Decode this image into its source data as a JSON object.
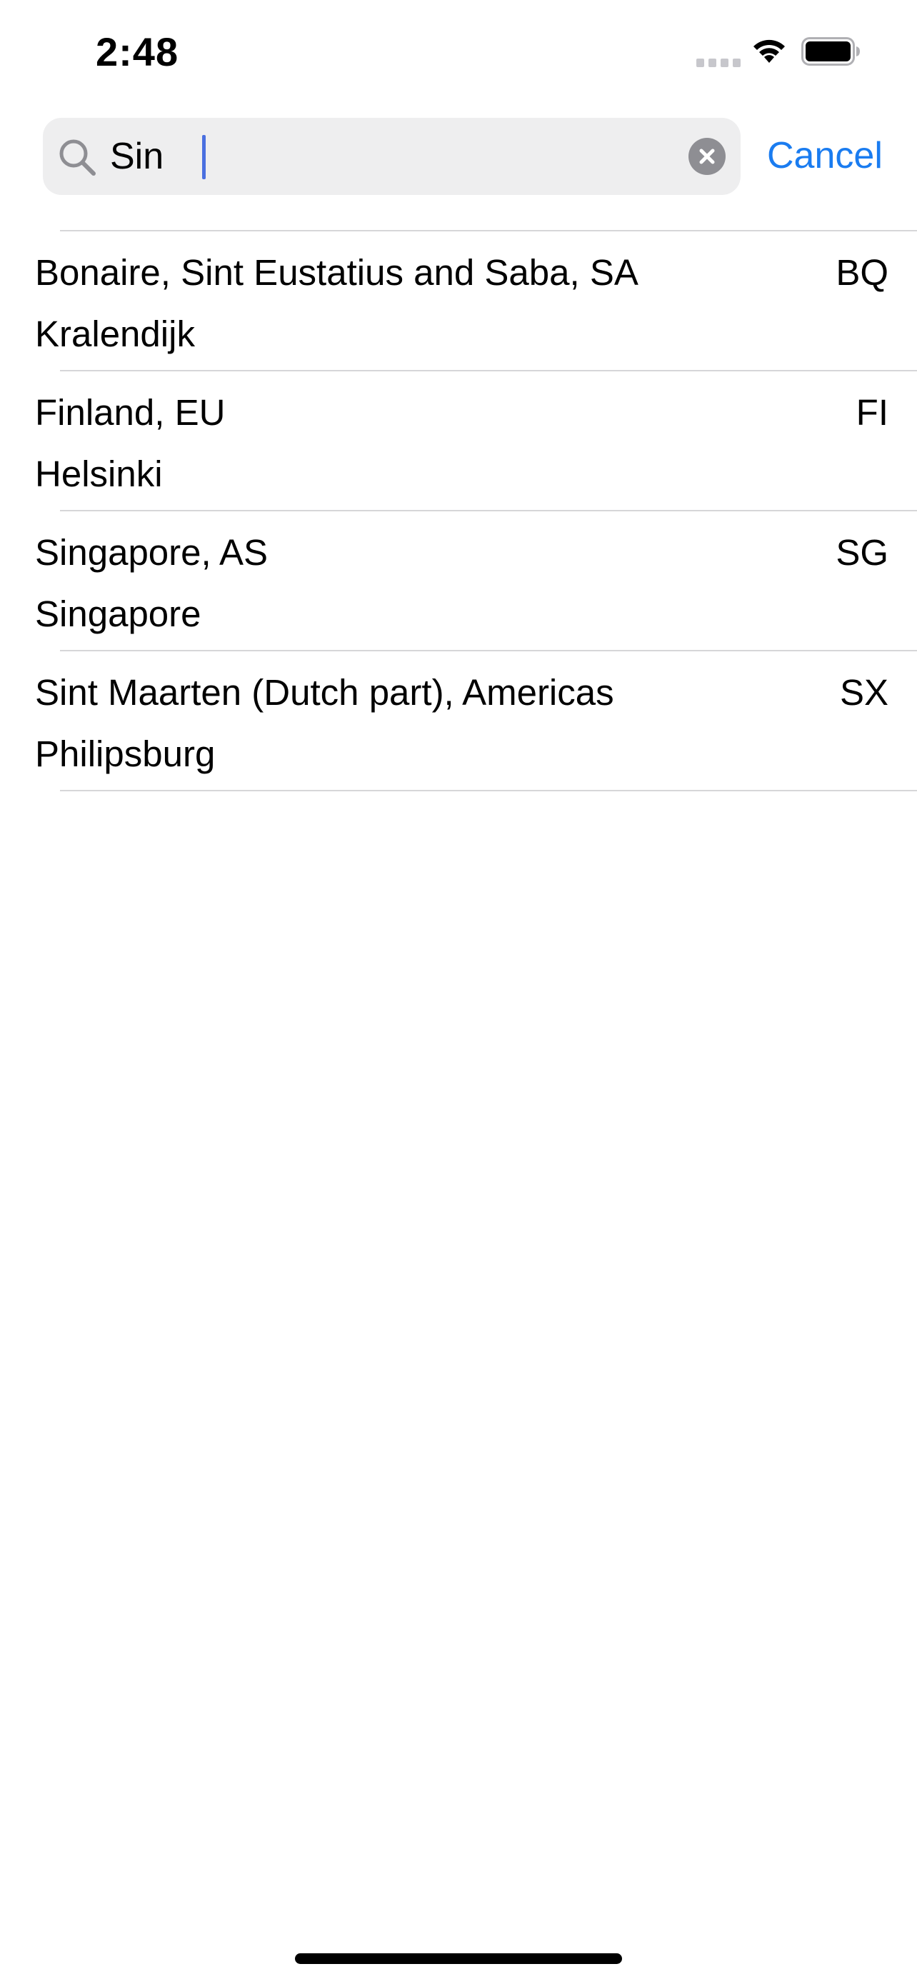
{
  "status_bar": {
    "time": "2:48",
    "icons": [
      "cellular-signal-icon",
      "wifi-icon",
      "battery-icon"
    ]
  },
  "search": {
    "value": "Sin",
    "cancel_label": "Cancel",
    "icon": "search-icon",
    "clear_icon": "clear-icon"
  },
  "results": [
    {
      "title": "Bonaire, Sint Eustatius and Saba, SA",
      "subtitle": "Kralendijk",
      "code": "BQ"
    },
    {
      "title": "Finland, EU",
      "subtitle": "Helsinki",
      "code": "FI"
    },
    {
      "title": "Singapore, AS",
      "subtitle": "Singapore",
      "code": "SG"
    },
    {
      "title": "Sint Maarten (Dutch part), Americas",
      "subtitle": "Philipsburg",
      "code": "SX"
    }
  ],
  "colors": {
    "accent": "#1a7cf0",
    "search_field_bg": "#eeeeef",
    "separator": "#d6d6d8",
    "clear_button": "#8e8e93",
    "caret": "#4a6fe0"
  }
}
